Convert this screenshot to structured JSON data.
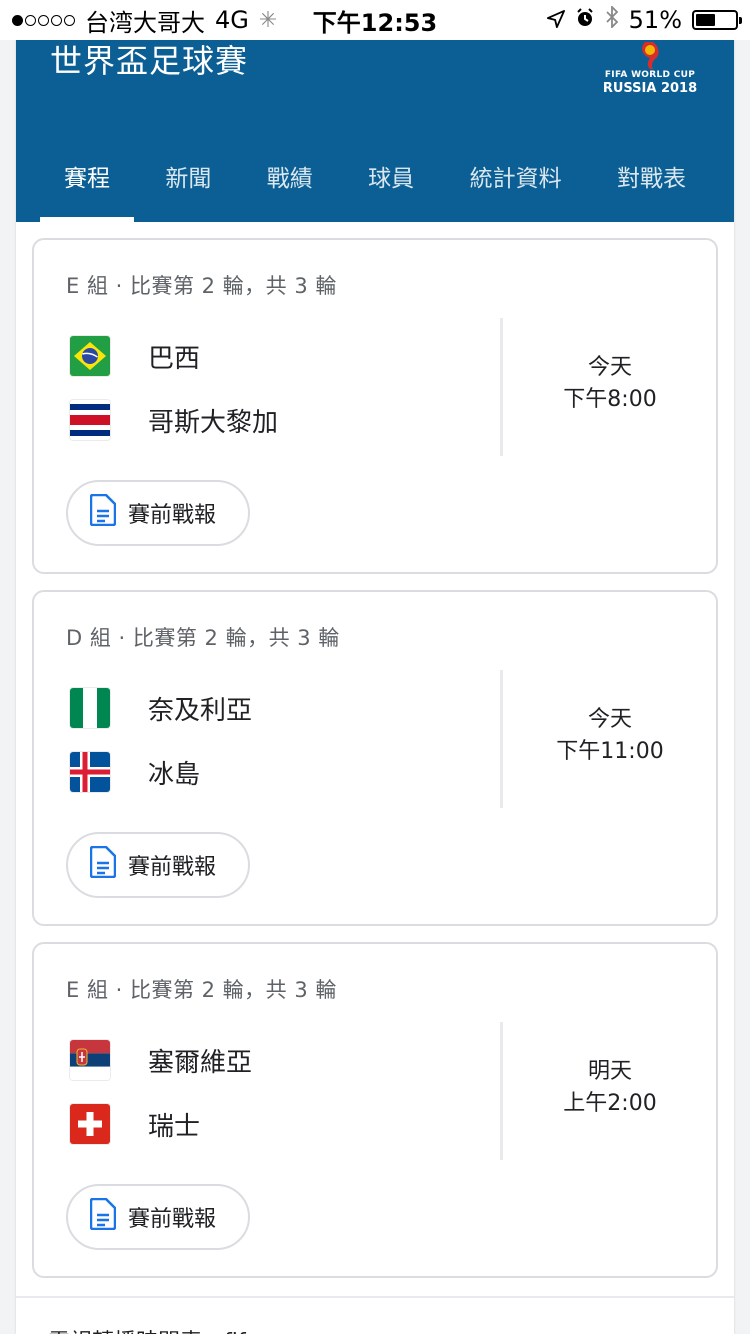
{
  "status_bar": {
    "carrier": "台湾大哥大",
    "network": "4G",
    "time": "下午12:53",
    "battery": "51%",
    "battery_level": 0.51
  },
  "header": {
    "title": "世界盃足球賽",
    "logo_line1": "FIFA WORLD CUP",
    "logo_line2": "RUSSIA 2018"
  },
  "tabs": [
    "賽程",
    "新聞",
    "戰績",
    "球員",
    "統計資料",
    "對戰表"
  ],
  "active_tab": 0,
  "matches": [
    {
      "group": "E 組 · 比賽第 2 輪，共 3 輪",
      "team1": {
        "name": "巴西",
        "flag": "brazil-flag-icon"
      },
      "team2": {
        "name": "哥斯大黎加",
        "flag": "costa-rica-flag-icon"
      },
      "day": "今天",
      "time": "下午8:00",
      "preview_label": "賽前戰報"
    },
    {
      "group": "D 組 · 比賽第 2 輪，共 3 輪",
      "team1": {
        "name": "奈及利亞",
        "flag": "nigeria-flag-icon"
      },
      "team2": {
        "name": "冰島",
        "flag": "iceland-flag-icon"
      },
      "day": "今天",
      "time": "下午11:00",
      "preview_label": "賽前戰報"
    },
    {
      "group": "E 組 · 比賽第 2 輪，共 3 輪",
      "team1": {
        "name": "塞爾維亞",
        "flag": "serbia-flag-icon"
      },
      "team2": {
        "name": "瑞士",
        "flag": "switzerland-flag-icon"
      },
      "day": "明天",
      "time": "上午2:00",
      "preview_label": "賽前戰報"
    }
  ],
  "bottom_hint": "電視轉播時間表：fifa.com",
  "colors": {
    "header_bg": "#0c5f94",
    "doc_icon": "#1a73e8"
  }
}
